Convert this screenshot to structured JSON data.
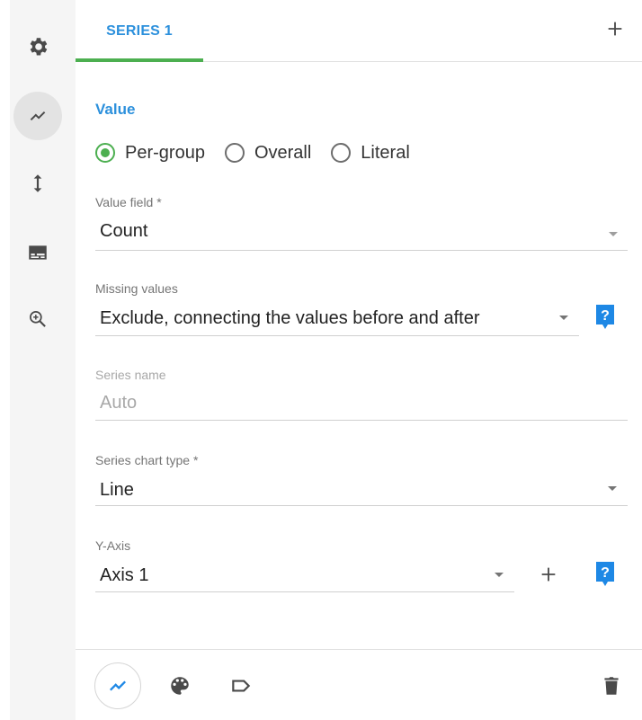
{
  "tabs": [
    {
      "label": "SERIES 1",
      "active": true
    }
  ],
  "value_section": {
    "title": "Value",
    "options": [
      {
        "label": "Per-group",
        "selected": true
      },
      {
        "label": "Overall",
        "selected": false
      },
      {
        "label": "Literal",
        "selected": false
      }
    ]
  },
  "fields": {
    "value_field": {
      "label": "Value field *",
      "value": "Count"
    },
    "missing_values": {
      "label": "Missing values",
      "value": "Exclude, connecting the values before and after"
    },
    "series_name": {
      "label": "Series name",
      "placeholder": "Auto"
    },
    "series_chart_type": {
      "label": "Series chart type *",
      "value": "Line"
    },
    "y_axis": {
      "label": "Y-Axis",
      "value": "Axis 1"
    }
  },
  "help_glyph": "?",
  "sidebar_icons": [
    "gear-icon",
    "line-chart-icon",
    "vertical-arrows-icon",
    "subtitles-icon",
    "zoom-in-icon"
  ],
  "footer_icons": [
    "line-chart-icon",
    "palette-icon",
    "label-icon",
    "trash-icon"
  ],
  "colors": {
    "accent_blue": "#2c90dc",
    "accent_green": "#4caf50",
    "help_blue": "#1e88e5"
  }
}
